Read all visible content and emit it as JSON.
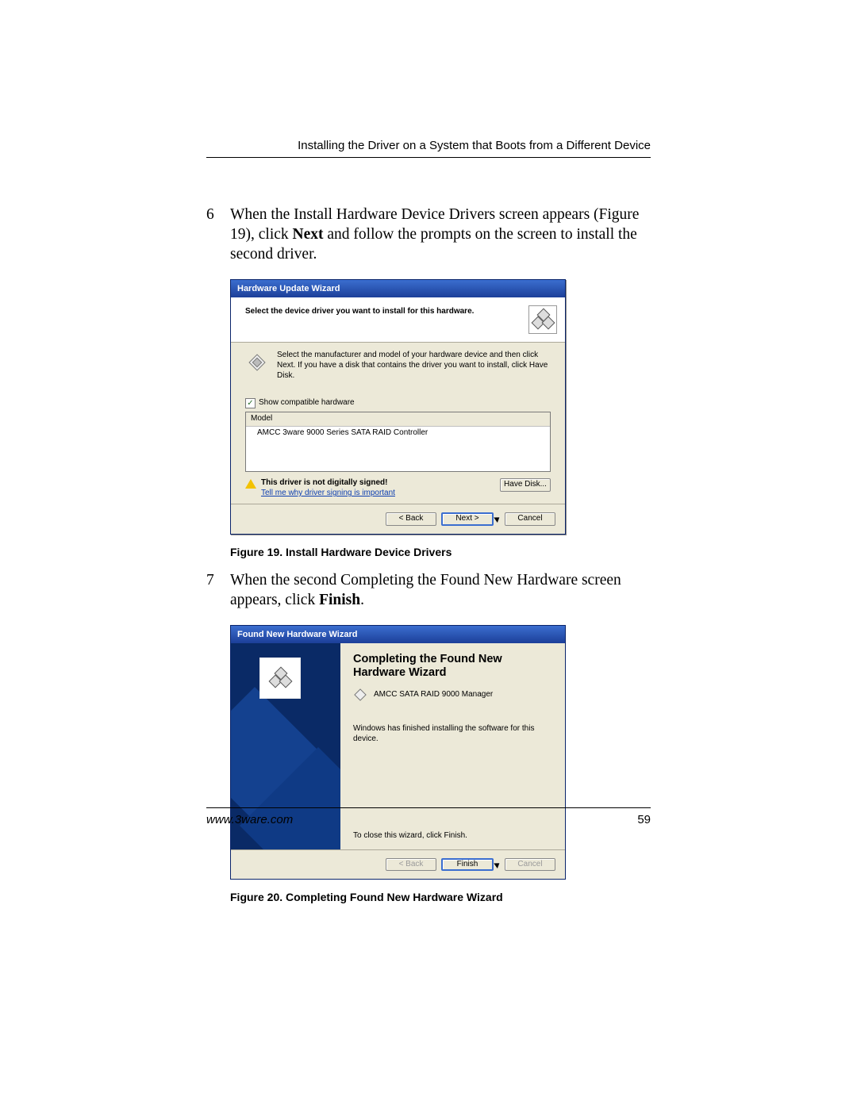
{
  "page": {
    "running_head": "Installing the Driver on a System that Boots from a Different Device",
    "footer_url": "www.3ware.com",
    "page_number": "59"
  },
  "steps": {
    "s6": {
      "num": "6",
      "text_a": "When the Install Hardware Device Drivers screen appears (Figure 19), click ",
      "bold": "Next",
      "text_b": " and follow the prompts on the screen to install the second driver."
    },
    "s7": {
      "num": "7",
      "text_a": "When the second Completing the Found New Hardware screen appears, click ",
      "bold": "Finish",
      "text_b": "."
    }
  },
  "captions": {
    "fig19": "Figure 19.   Install Hardware Device Drivers",
    "fig20": "Figure 20.   Completing Found New Hardware Wizard"
  },
  "wiz1": {
    "title": "Hardware Update Wizard",
    "header": "Select the device driver you want to install for this hardware.",
    "instruction": "Select the manufacturer and model of your hardware device and then click Next. If you have a disk that contains the driver you want to install, click Have Disk.",
    "checkbox_label": "Show compatible hardware",
    "list_header": "Model",
    "list_item": "AMCC 3ware 9000 Series SATA RAID Controller",
    "warn_line1": "This driver is not digitally signed!",
    "warn_line2": "Tell me why driver signing is important",
    "btn_havedisk": "Have Disk...",
    "btn_back": "< Back",
    "btn_next": "Next >",
    "btn_cancel": "Cancel"
  },
  "wiz2": {
    "title": "Found New Hardware Wizard",
    "heading": "Completing the Found New Hardware Wizard",
    "device": "AMCC SATA RAID 9000 Manager",
    "done_text": "Windows has finished installing the software for this device.",
    "close_hint": "To close this wizard, click Finish.",
    "btn_back": "< Back",
    "btn_finish": "Finish",
    "btn_cancel": "Cancel"
  }
}
